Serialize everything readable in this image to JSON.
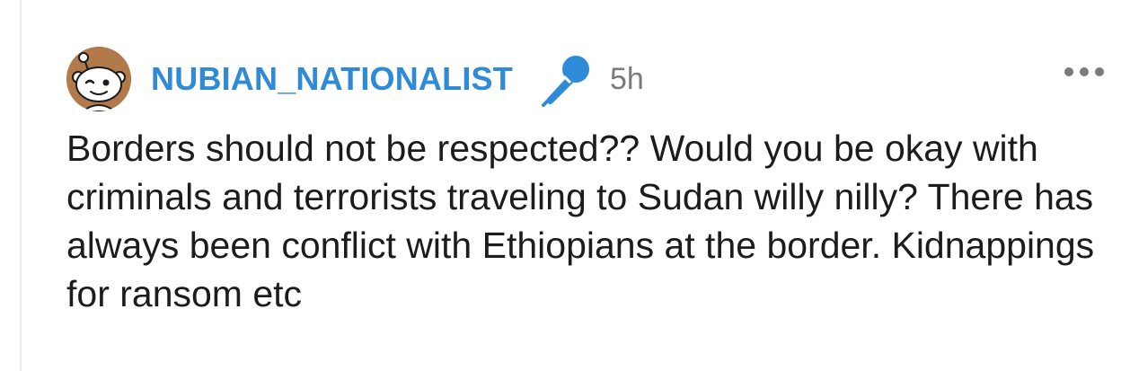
{
  "comment": {
    "author": "NUBIAN_NATIONALIST",
    "author_color": "#2f8ad8",
    "flair_icon": "microphone-icon",
    "flair_color": "#2f8ad8",
    "time_ago": "5h",
    "more_icon": "more-options-icon",
    "avatar_icon": "snoo-avatar-icon",
    "body": "Borders should not be respected?? Would you be okay with criminals and terrorists traveling to Sudan willy nilly? There has always been conflict with Ethiopians at the border. Kidnappings for ransom etc"
  }
}
